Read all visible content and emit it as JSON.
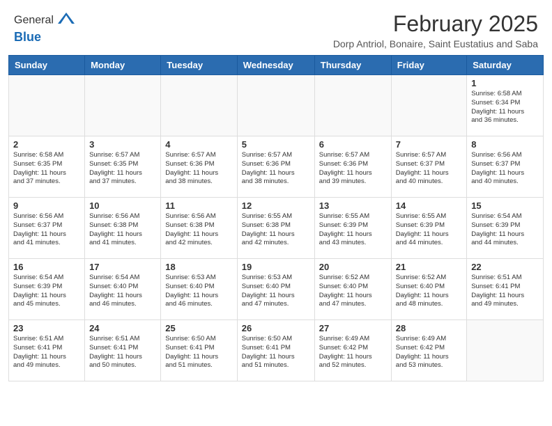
{
  "header": {
    "logo_general": "General",
    "logo_blue": "Blue",
    "month_year": "February 2025",
    "location": "Dorp Antriol, Bonaire, Saint Eustatius and Saba"
  },
  "weekdays": [
    "Sunday",
    "Monday",
    "Tuesday",
    "Wednesday",
    "Thursday",
    "Friday",
    "Saturday"
  ],
  "weeks": [
    [
      {
        "day": "",
        "info": ""
      },
      {
        "day": "",
        "info": ""
      },
      {
        "day": "",
        "info": ""
      },
      {
        "day": "",
        "info": ""
      },
      {
        "day": "",
        "info": ""
      },
      {
        "day": "",
        "info": ""
      },
      {
        "day": "1",
        "info": "Sunrise: 6:58 AM\nSunset: 6:34 PM\nDaylight: 11 hours\nand 36 minutes."
      }
    ],
    [
      {
        "day": "2",
        "info": "Sunrise: 6:58 AM\nSunset: 6:35 PM\nDaylight: 11 hours\nand 37 minutes."
      },
      {
        "day": "3",
        "info": "Sunrise: 6:57 AM\nSunset: 6:35 PM\nDaylight: 11 hours\nand 37 minutes."
      },
      {
        "day": "4",
        "info": "Sunrise: 6:57 AM\nSunset: 6:36 PM\nDaylight: 11 hours\nand 38 minutes."
      },
      {
        "day": "5",
        "info": "Sunrise: 6:57 AM\nSunset: 6:36 PM\nDaylight: 11 hours\nand 38 minutes."
      },
      {
        "day": "6",
        "info": "Sunrise: 6:57 AM\nSunset: 6:36 PM\nDaylight: 11 hours\nand 39 minutes."
      },
      {
        "day": "7",
        "info": "Sunrise: 6:57 AM\nSunset: 6:37 PM\nDaylight: 11 hours\nand 40 minutes."
      },
      {
        "day": "8",
        "info": "Sunrise: 6:56 AM\nSunset: 6:37 PM\nDaylight: 11 hours\nand 40 minutes."
      }
    ],
    [
      {
        "day": "9",
        "info": "Sunrise: 6:56 AM\nSunset: 6:37 PM\nDaylight: 11 hours\nand 41 minutes."
      },
      {
        "day": "10",
        "info": "Sunrise: 6:56 AM\nSunset: 6:38 PM\nDaylight: 11 hours\nand 41 minutes."
      },
      {
        "day": "11",
        "info": "Sunrise: 6:56 AM\nSunset: 6:38 PM\nDaylight: 11 hours\nand 42 minutes."
      },
      {
        "day": "12",
        "info": "Sunrise: 6:55 AM\nSunset: 6:38 PM\nDaylight: 11 hours\nand 42 minutes."
      },
      {
        "day": "13",
        "info": "Sunrise: 6:55 AM\nSunset: 6:39 PM\nDaylight: 11 hours\nand 43 minutes."
      },
      {
        "day": "14",
        "info": "Sunrise: 6:55 AM\nSunset: 6:39 PM\nDaylight: 11 hours\nand 44 minutes."
      },
      {
        "day": "15",
        "info": "Sunrise: 6:54 AM\nSunset: 6:39 PM\nDaylight: 11 hours\nand 44 minutes."
      }
    ],
    [
      {
        "day": "16",
        "info": "Sunrise: 6:54 AM\nSunset: 6:39 PM\nDaylight: 11 hours\nand 45 minutes."
      },
      {
        "day": "17",
        "info": "Sunrise: 6:54 AM\nSunset: 6:40 PM\nDaylight: 11 hours\nand 46 minutes."
      },
      {
        "day": "18",
        "info": "Sunrise: 6:53 AM\nSunset: 6:40 PM\nDaylight: 11 hours\nand 46 minutes."
      },
      {
        "day": "19",
        "info": "Sunrise: 6:53 AM\nSunset: 6:40 PM\nDaylight: 11 hours\nand 47 minutes."
      },
      {
        "day": "20",
        "info": "Sunrise: 6:52 AM\nSunset: 6:40 PM\nDaylight: 11 hours\nand 47 minutes."
      },
      {
        "day": "21",
        "info": "Sunrise: 6:52 AM\nSunset: 6:40 PM\nDaylight: 11 hours\nand 48 minutes."
      },
      {
        "day": "22",
        "info": "Sunrise: 6:51 AM\nSunset: 6:41 PM\nDaylight: 11 hours\nand 49 minutes."
      }
    ],
    [
      {
        "day": "23",
        "info": "Sunrise: 6:51 AM\nSunset: 6:41 PM\nDaylight: 11 hours\nand 49 minutes."
      },
      {
        "day": "24",
        "info": "Sunrise: 6:51 AM\nSunset: 6:41 PM\nDaylight: 11 hours\nand 50 minutes."
      },
      {
        "day": "25",
        "info": "Sunrise: 6:50 AM\nSunset: 6:41 PM\nDaylight: 11 hours\nand 51 minutes."
      },
      {
        "day": "26",
        "info": "Sunrise: 6:50 AM\nSunset: 6:41 PM\nDaylight: 11 hours\nand 51 minutes."
      },
      {
        "day": "27",
        "info": "Sunrise: 6:49 AM\nSunset: 6:42 PM\nDaylight: 11 hours\nand 52 minutes."
      },
      {
        "day": "28",
        "info": "Sunrise: 6:49 AM\nSunset: 6:42 PM\nDaylight: 11 hours\nand 53 minutes."
      },
      {
        "day": "",
        "info": ""
      }
    ]
  ]
}
